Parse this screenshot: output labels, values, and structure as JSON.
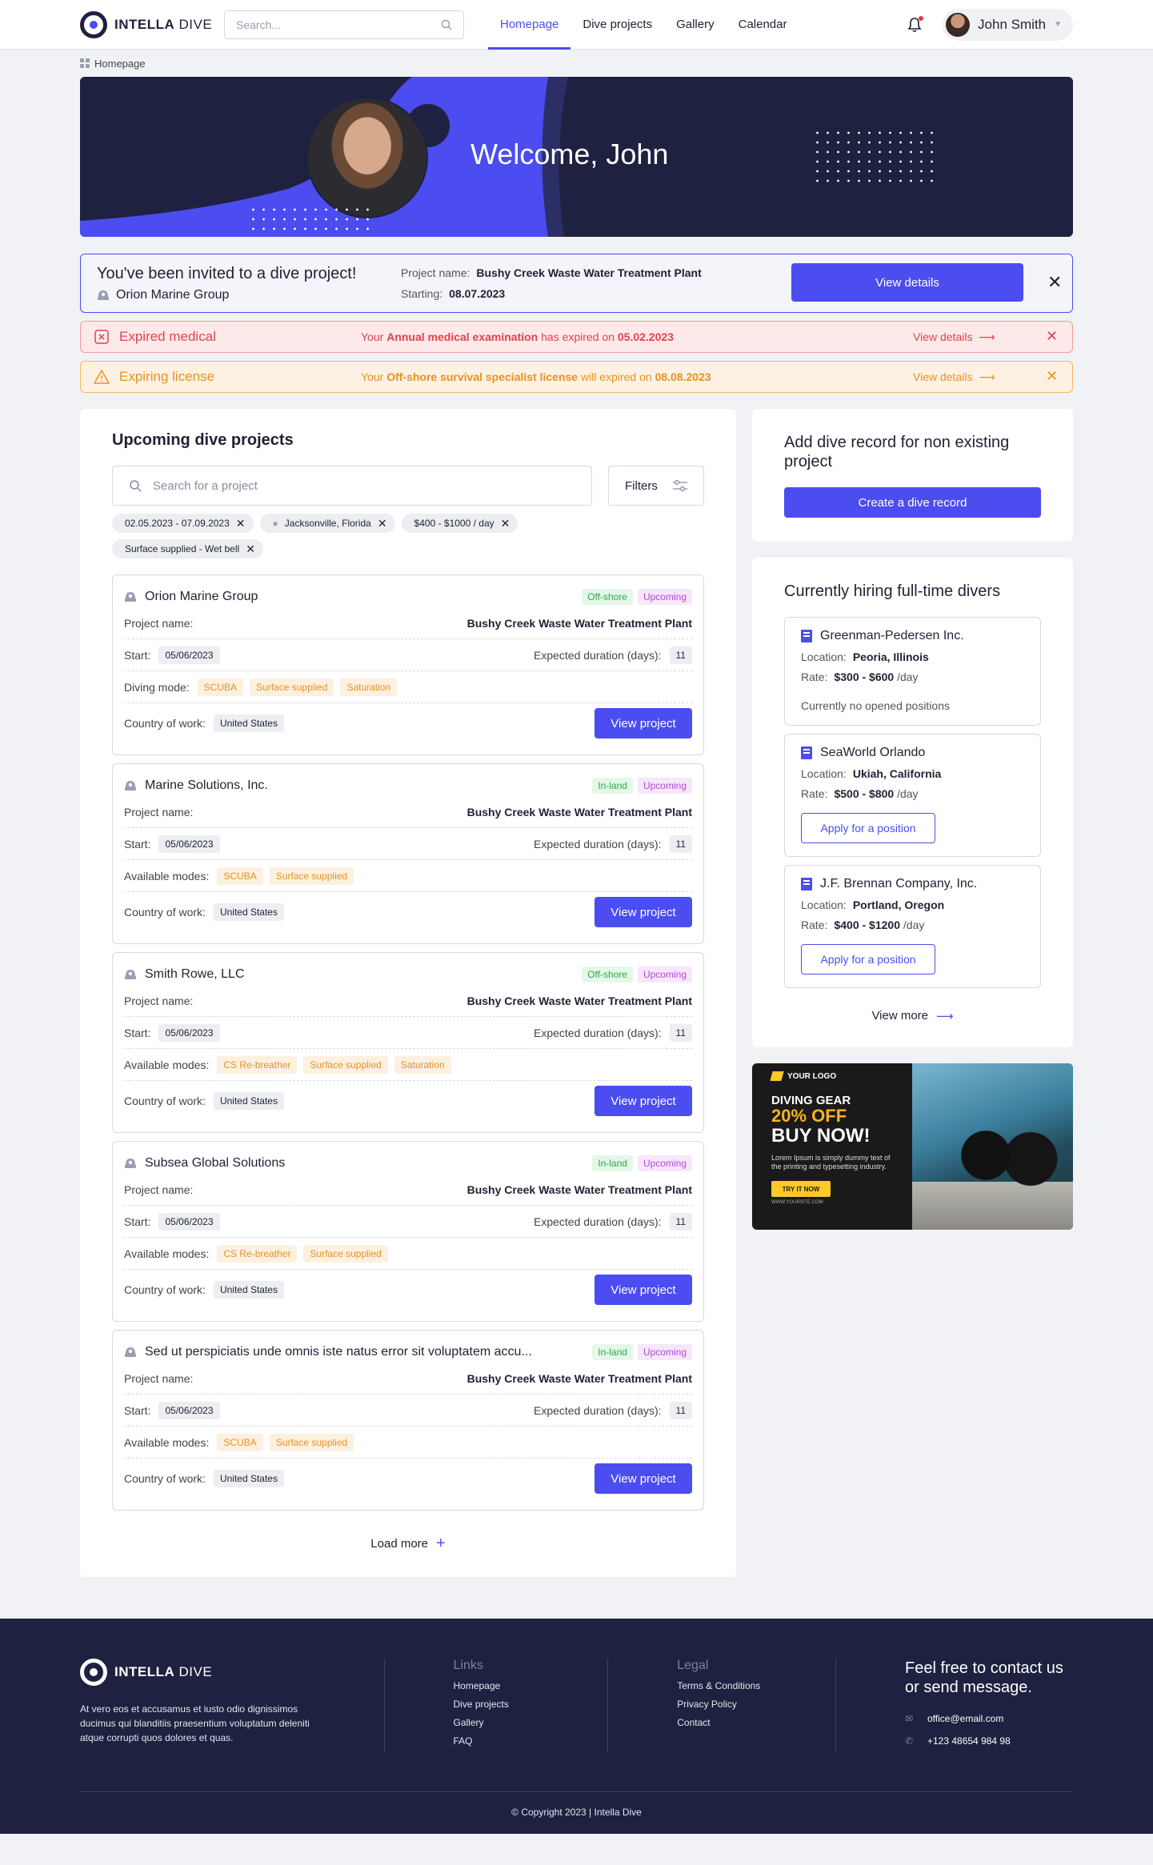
{
  "brand": {
    "name_bold": "INTELLA",
    "name_light": "DIVE"
  },
  "search": {
    "placeholder": "Search..."
  },
  "nav": {
    "items": [
      "Homepage",
      "Dive projects",
      "Gallery",
      "Calendar"
    ]
  },
  "user": {
    "name": "John Smith"
  },
  "breadcrumb": {
    "current": "Homepage"
  },
  "hero": {
    "welcome": "Welcome, John"
  },
  "invite": {
    "title": "You've been invited to a dive project!",
    "org": "Orion Marine Group",
    "project_label": "Project name:",
    "project_value": "Bushy Creek Waste Water Treatment Plant",
    "starting_label": "Starting:",
    "starting_value": "08.07.2023",
    "button": "View details"
  },
  "alerts": [
    {
      "title": "Expired medical",
      "msg_pre": "Your ",
      "msg_bold": "Annual medical examination",
      "msg_mid": " has expired on ",
      "msg_date": "05.02.2023",
      "link": "View details"
    },
    {
      "title": "Expiring license",
      "msg_pre": "Your ",
      "msg_bold": "Off-shore survival specialist license",
      "msg_mid": " will expired on ",
      "msg_date": "08.08.2023",
      "link": "View details"
    }
  ],
  "projects_section": {
    "title": "Upcoming dive projects",
    "search_placeholder": "Search for a project",
    "filters_label": "Filters",
    "chips": [
      "02.05.2023 - 07.09.2023",
      "Jacksonville, Florida",
      "$400 - $1000 / day",
      "Surface supplied - Wet bell"
    ],
    "labels": {
      "project_name": "Project name:",
      "start": "Start:",
      "duration": "Expected duration (days):",
      "diving_mode": "Diving mode:",
      "available_modes": "Available modes:",
      "country": "Country of work:",
      "view": "View project"
    },
    "load_more": "Load more",
    "projects": [
      {
        "org": "Orion Marine Group",
        "badge_type": "Off-shore",
        "badge_type_color": "green",
        "badge_status": "Upcoming",
        "project_name": "Bushy Creek Waste Water Treatment Plant",
        "start": "05/06/2023",
        "duration": "11",
        "modes_label": "Diving mode:",
        "modes": [
          "SCUBA",
          "Surface supplied",
          "Saturation"
        ],
        "country": "United States"
      },
      {
        "org": "Marine Solutions, Inc.",
        "badge_type": "In-land",
        "badge_type_color": "green",
        "badge_status": "Upcoming",
        "project_name": "Bushy Creek Waste Water Treatment Plant",
        "start": "05/06/2023",
        "duration": "11",
        "modes_label": "Available modes:",
        "modes": [
          "SCUBA",
          "Surface supplied"
        ],
        "country": "United States"
      },
      {
        "org": "Smith Rowe, LLC",
        "badge_type": "Off-shore",
        "badge_type_color": "green",
        "badge_status": "Upcoming",
        "project_name": "Bushy Creek Waste Water Treatment Plant",
        "start": "05/06/2023",
        "duration": "11",
        "modes_label": "Available modes:",
        "modes": [
          "CS Re-breather",
          "Surface supplied",
          "Saturation"
        ],
        "country": "United States"
      },
      {
        "org": "Subsea Global Solutions",
        "badge_type": "In-land",
        "badge_type_color": "green",
        "badge_status": "Upcoming",
        "project_name": "Bushy Creek Waste Water Treatment Plant",
        "start": "05/06/2023",
        "duration": "11",
        "modes_label": "Available modes:",
        "modes": [
          "CS Re-breather",
          "Surface supplied"
        ],
        "country": "United States"
      },
      {
        "org": "Sed ut perspiciatis unde omnis iste natus error sit voluptatem accu...",
        "badge_type": "In-land",
        "badge_type_color": "green",
        "badge_status": "Upcoming",
        "project_name": "Bushy Creek Waste Water Treatment Plant",
        "start": "05/06/2023",
        "duration": "11",
        "modes_label": "Available modes:",
        "modes": [
          "SCUBA",
          "Surface supplied"
        ],
        "country": "United States"
      }
    ]
  },
  "add_record": {
    "title": "Add dive record for non existing project",
    "button": "Create a dive record"
  },
  "hiring": {
    "title": "Currently hiring full-time divers",
    "location_label": "Location:",
    "rate_label": "Rate:",
    "per_day": "/day",
    "apply": "Apply for a position",
    "companies": [
      {
        "name": "Greenman-Pedersen Inc.",
        "location": "Peoria, Illinois",
        "rate": "$300 - $600",
        "note": "Currently no opened positions"
      },
      {
        "name": "SeaWorld Orlando",
        "location": "Ukiah, California",
        "rate": "$500 - $800",
        "note": ""
      },
      {
        "name": "J.F. Brennan Company, Inc.",
        "location": "Portland, Oregon",
        "rate": "$400 - $1200",
        "note": ""
      }
    ],
    "view_more": "View more"
  },
  "ad": {
    "logo": "YOUR LOGO",
    "line1": "DIVING GEAR",
    "line2": "20% OFF",
    "line3": "BUY NOW!",
    "body": "Lorem Ipsum is simply dummy text of the printing and typesetting industry.",
    "button": "TRY IT NOW",
    "url": "WWW.YOURSITE.COM"
  },
  "footer": {
    "description": "At vero eos et accusamus et iusto odio dignissimos ducimus qui blanditiis praesentium voluptatum deleniti atque corrupti quos dolores et quas.",
    "links_title": "Links",
    "links": [
      "Homepage",
      "Dive projects",
      "Gallery",
      "FAQ"
    ],
    "legal_title": "Legal",
    "legal": [
      "Terms & Conditions",
      "Privacy Policy",
      "Contact"
    ],
    "contact_title": "Feel free to contact us or send message.",
    "email": "office@email.com",
    "phone": "+123 48654 984 98",
    "copyright": "© Copyright 2023 | Intella Dive"
  },
  "colors": {
    "accent": "#4b4df0",
    "navy": "#1e2140",
    "error": "#e2434b",
    "warning": "#e8931e"
  }
}
